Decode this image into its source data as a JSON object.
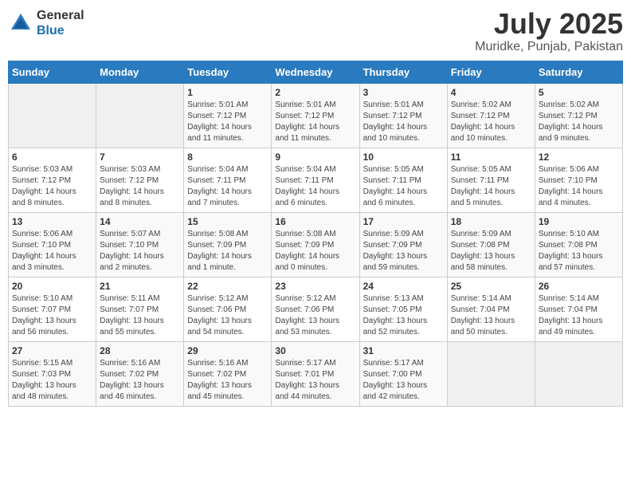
{
  "header": {
    "logo_general": "General",
    "logo_blue": "Blue",
    "month_title": "July 2025",
    "location": "Muridke, Punjab, Pakistan"
  },
  "weekdays": [
    "Sunday",
    "Monday",
    "Tuesday",
    "Wednesday",
    "Thursday",
    "Friday",
    "Saturday"
  ],
  "weeks": [
    [
      {
        "day": "",
        "detail": ""
      },
      {
        "day": "",
        "detail": ""
      },
      {
        "day": "1",
        "detail": "Sunrise: 5:01 AM\nSunset: 7:12 PM\nDaylight: 14 hours\nand 11 minutes."
      },
      {
        "day": "2",
        "detail": "Sunrise: 5:01 AM\nSunset: 7:12 PM\nDaylight: 14 hours\nand 11 minutes."
      },
      {
        "day": "3",
        "detail": "Sunrise: 5:01 AM\nSunset: 7:12 PM\nDaylight: 14 hours\nand 10 minutes."
      },
      {
        "day": "4",
        "detail": "Sunrise: 5:02 AM\nSunset: 7:12 PM\nDaylight: 14 hours\nand 10 minutes."
      },
      {
        "day": "5",
        "detail": "Sunrise: 5:02 AM\nSunset: 7:12 PM\nDaylight: 14 hours\nand 9 minutes."
      }
    ],
    [
      {
        "day": "6",
        "detail": "Sunrise: 5:03 AM\nSunset: 7:12 PM\nDaylight: 14 hours\nand 8 minutes."
      },
      {
        "day": "7",
        "detail": "Sunrise: 5:03 AM\nSunset: 7:12 PM\nDaylight: 14 hours\nand 8 minutes."
      },
      {
        "day": "8",
        "detail": "Sunrise: 5:04 AM\nSunset: 7:11 PM\nDaylight: 14 hours\nand 7 minutes."
      },
      {
        "day": "9",
        "detail": "Sunrise: 5:04 AM\nSunset: 7:11 PM\nDaylight: 14 hours\nand 6 minutes."
      },
      {
        "day": "10",
        "detail": "Sunrise: 5:05 AM\nSunset: 7:11 PM\nDaylight: 14 hours\nand 6 minutes."
      },
      {
        "day": "11",
        "detail": "Sunrise: 5:05 AM\nSunset: 7:11 PM\nDaylight: 14 hours\nand 5 minutes."
      },
      {
        "day": "12",
        "detail": "Sunrise: 5:06 AM\nSunset: 7:10 PM\nDaylight: 14 hours\nand 4 minutes."
      }
    ],
    [
      {
        "day": "13",
        "detail": "Sunrise: 5:06 AM\nSunset: 7:10 PM\nDaylight: 14 hours\nand 3 minutes."
      },
      {
        "day": "14",
        "detail": "Sunrise: 5:07 AM\nSunset: 7:10 PM\nDaylight: 14 hours\nand 2 minutes."
      },
      {
        "day": "15",
        "detail": "Sunrise: 5:08 AM\nSunset: 7:09 PM\nDaylight: 14 hours\nand 1 minute."
      },
      {
        "day": "16",
        "detail": "Sunrise: 5:08 AM\nSunset: 7:09 PM\nDaylight: 14 hours\nand 0 minutes."
      },
      {
        "day": "17",
        "detail": "Sunrise: 5:09 AM\nSunset: 7:09 PM\nDaylight: 13 hours\nand 59 minutes."
      },
      {
        "day": "18",
        "detail": "Sunrise: 5:09 AM\nSunset: 7:08 PM\nDaylight: 13 hours\nand 58 minutes."
      },
      {
        "day": "19",
        "detail": "Sunrise: 5:10 AM\nSunset: 7:08 PM\nDaylight: 13 hours\nand 57 minutes."
      }
    ],
    [
      {
        "day": "20",
        "detail": "Sunrise: 5:10 AM\nSunset: 7:07 PM\nDaylight: 13 hours\nand 56 minutes."
      },
      {
        "day": "21",
        "detail": "Sunrise: 5:11 AM\nSunset: 7:07 PM\nDaylight: 13 hours\nand 55 minutes."
      },
      {
        "day": "22",
        "detail": "Sunrise: 5:12 AM\nSunset: 7:06 PM\nDaylight: 13 hours\nand 54 minutes."
      },
      {
        "day": "23",
        "detail": "Sunrise: 5:12 AM\nSunset: 7:06 PM\nDaylight: 13 hours\nand 53 minutes."
      },
      {
        "day": "24",
        "detail": "Sunrise: 5:13 AM\nSunset: 7:05 PM\nDaylight: 13 hours\nand 52 minutes."
      },
      {
        "day": "25",
        "detail": "Sunrise: 5:14 AM\nSunset: 7:04 PM\nDaylight: 13 hours\nand 50 minutes."
      },
      {
        "day": "26",
        "detail": "Sunrise: 5:14 AM\nSunset: 7:04 PM\nDaylight: 13 hours\nand 49 minutes."
      }
    ],
    [
      {
        "day": "27",
        "detail": "Sunrise: 5:15 AM\nSunset: 7:03 PM\nDaylight: 13 hours\nand 48 minutes."
      },
      {
        "day": "28",
        "detail": "Sunrise: 5:16 AM\nSunset: 7:02 PM\nDaylight: 13 hours\nand 46 minutes."
      },
      {
        "day": "29",
        "detail": "Sunrise: 5:16 AM\nSunset: 7:02 PM\nDaylight: 13 hours\nand 45 minutes."
      },
      {
        "day": "30",
        "detail": "Sunrise: 5:17 AM\nSunset: 7:01 PM\nDaylight: 13 hours\nand 44 minutes."
      },
      {
        "day": "31",
        "detail": "Sunrise: 5:17 AM\nSunset: 7:00 PM\nDaylight: 13 hours\nand 42 minutes."
      },
      {
        "day": "",
        "detail": ""
      },
      {
        "day": "",
        "detail": ""
      }
    ]
  ]
}
